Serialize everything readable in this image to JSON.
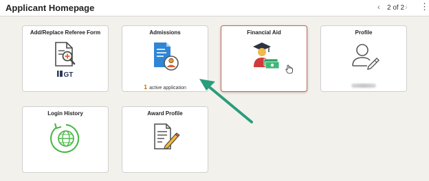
{
  "header": {
    "title": "Applicant Homepage",
    "chevron": "⌄",
    "pager_prev": "‹",
    "pager_text": "2 of 2",
    "pager_next": "›",
    "menu": "⋮"
  },
  "tiles": [
    {
      "title": "Add/Replace Referee Form",
      "icon": "document-search-icon",
      "logo_text": "GT"
    },
    {
      "title": "Admissions",
      "icon": "application-document-icon",
      "count": "1",
      "footer": "active application"
    },
    {
      "title": "Financial Aid",
      "icon": "graduate-money-icon"
    },
    {
      "title": "Profile",
      "icon": "user-edit-icon"
    },
    {
      "title": "Login History",
      "icon": "globe-history-icon"
    },
    {
      "title": "Award Profile",
      "icon": "document-edit-icon"
    }
  ],
  "colors": {
    "page_bg": "#f3f1ec",
    "accent_orange": "#c8720a",
    "annotation_arrow": "#2a9d7c",
    "active_border": "#b56a5c"
  }
}
